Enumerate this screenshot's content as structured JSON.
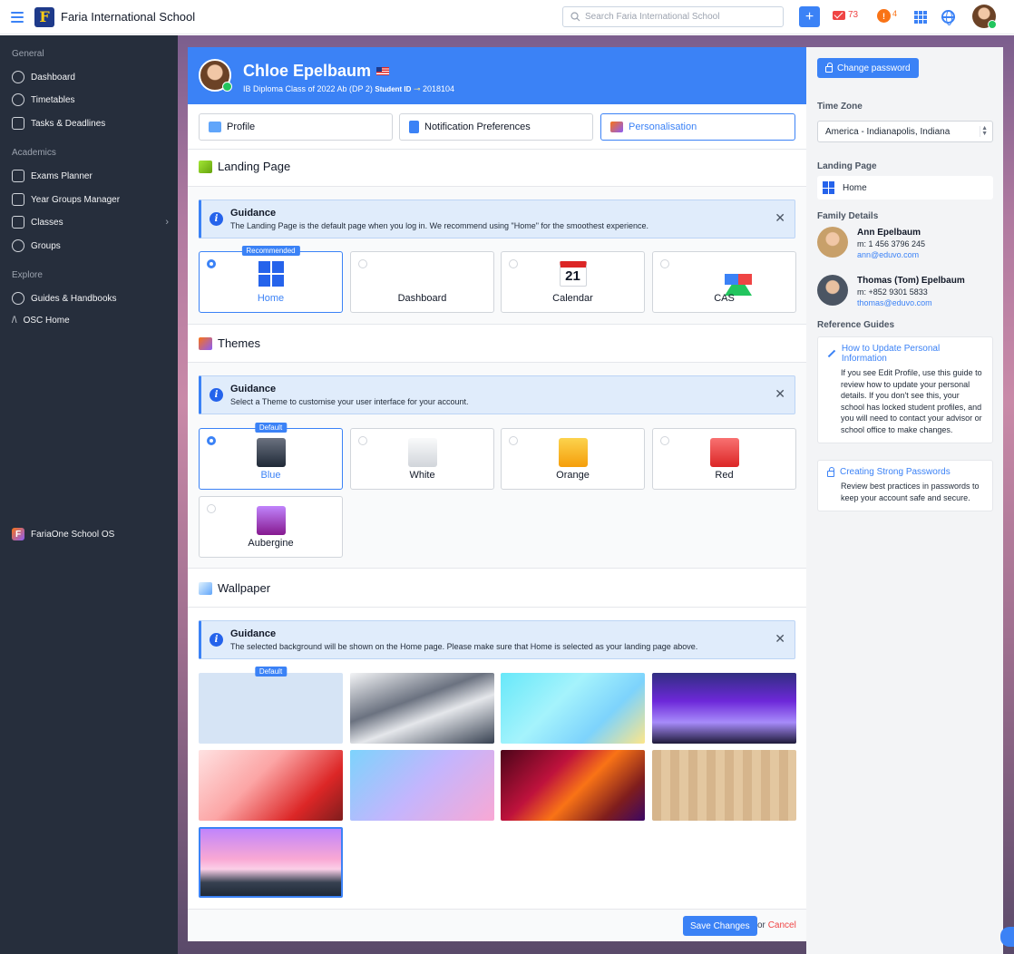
{
  "topbar": {
    "school_name": "Faria International School",
    "logo_letter": "F",
    "search_placeholder": "Search Faria International School",
    "plus": "+",
    "mail_count": "73",
    "notif_count": "4"
  },
  "sidebar": {
    "general_title": "General",
    "general": [
      "Dashboard",
      "Timetables",
      "Tasks & Deadlines"
    ],
    "academics_title": "Academics",
    "academics": [
      "Exams Planner",
      "Year Groups Manager",
      "Classes",
      "Groups"
    ],
    "explore_title": "Explore",
    "explore": [
      "Guides & Handbooks",
      "OSC Home"
    ],
    "faria_one": "FariaOne School OS"
  },
  "profile": {
    "name": "Chloe Epelbaum",
    "class_text": "IB Diploma Class of 2022 Ab (DP 2)",
    "student_id_label": "Student ID",
    "student_id": "2018104"
  },
  "tabs": [
    "Profile",
    "Notification Preferences",
    "Personalisation"
  ],
  "landing": {
    "title": "Landing Page",
    "guidance_title": "Guidance",
    "guidance_text": "The Landing Page is the default page when you log in. We recommend using \"Home\" for the smoothest experience.",
    "badge": "Recommended",
    "calendar_day": "21",
    "options": [
      "Home",
      "Dashboard",
      "Calendar",
      "CAS"
    ]
  },
  "themes": {
    "title": "Themes",
    "guidance_title": "Guidance",
    "guidance_text": "Select a Theme to customise your user interface for your account.",
    "badge": "Default",
    "options": [
      "Blue",
      "White",
      "Orange",
      "Red",
      "Aubergine"
    ]
  },
  "wallpaper": {
    "title": "Wallpaper",
    "guidance_title": "Guidance",
    "guidance_text": "The selected background will be shown on the Home page. Please make sure that Home is selected as your landing page above.",
    "badge": "Default"
  },
  "footer": {
    "save": "Save Changes",
    "or": "or",
    "cancel": "Cancel"
  },
  "right": {
    "change_password": "Change password",
    "time_zone_label": "Time Zone",
    "time_zone": "America - Indianapolis, Indiana",
    "landing_label": "Landing Page",
    "landing_value": "Home",
    "family_label": "Family Details",
    "family": [
      {
        "name": "Ann Epelbaum",
        "phone": "m: 1 456 3796 245",
        "email": "ann@eduvo.com"
      },
      {
        "name": "Thomas (Tom) Epelbaum",
        "phone": "m: +852 9301 5833",
        "email": "thomas@eduvo.com"
      }
    ],
    "ref_label": "Reference Guides",
    "guides": [
      {
        "title": "How to Update Personal Information",
        "text": "If you see Edit Profile, use this guide to review how to update your personal details. If you don't see this, your school has locked student profiles, and you will need to contact your advisor or school office to make changes."
      },
      {
        "title": "Creating Strong Passwords",
        "text": "Review best practices in passwords to keep your account safe and secure."
      }
    ]
  },
  "colors": {
    "accent": "#3b82f6",
    "sidebar": "#262e3c",
    "danger": "#ef4444"
  }
}
